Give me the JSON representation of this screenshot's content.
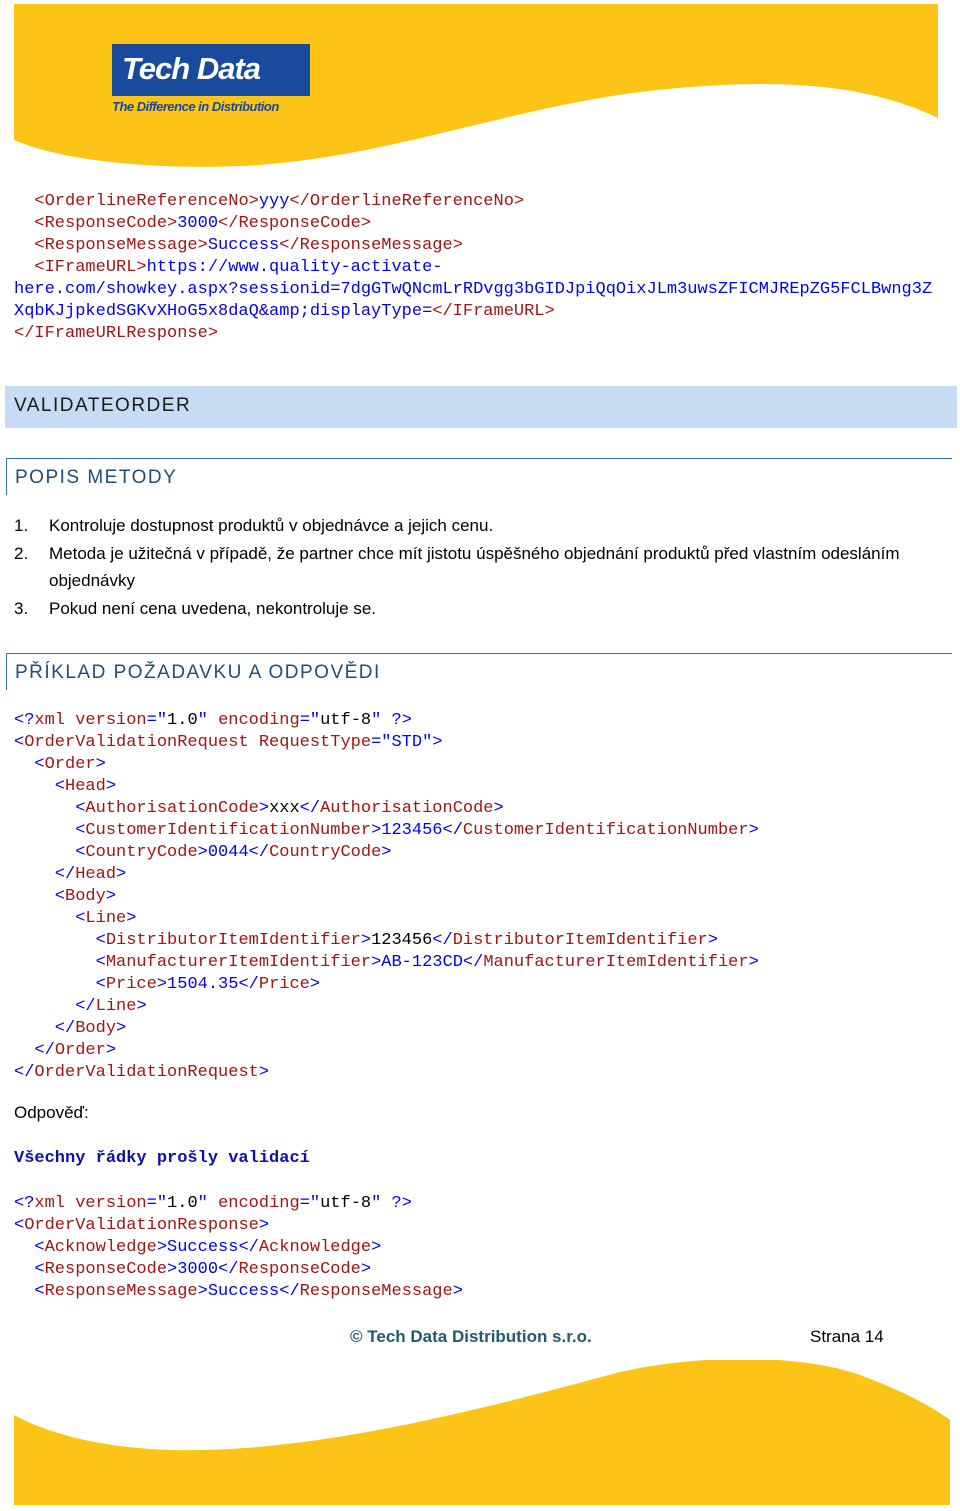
{
  "header": {
    "logo_text": "Tech Data",
    "logo_tagline": "The Difference in Distribution",
    "colors": {
      "wave": "#fcc417",
      "logo_bg": "#1a4a9c"
    }
  },
  "code_top": [
    [
      [
        "  ",
        ""
      ],
      [
        "<OrderlineReferenceNo>",
        "r"
      ],
      [
        "yyy",
        "b"
      ],
      [
        "</OrderlineReferenceNo>",
        "r"
      ]
    ],
    [
      [
        "  ",
        ""
      ],
      [
        "<ResponseCode>",
        "r"
      ],
      [
        "3000",
        "b"
      ],
      [
        "</ResponseCode>",
        "r"
      ]
    ],
    [
      [
        "  ",
        ""
      ],
      [
        "<ResponseMessage>",
        "r"
      ],
      [
        "Success",
        "b"
      ],
      [
        "</ResponseMessage>",
        "r"
      ]
    ],
    [
      [
        "  ",
        ""
      ],
      [
        "<IFrameURL>",
        "r"
      ],
      [
        "https://www.quality-activate-",
        "b"
      ]
    ],
    [
      [
        "here.com/showkey.aspx?sessionid=7dgGTwQNcmLrRDvgg3bGIDJpiQqOixJLm3uwsZFICMJREpZG5FCLBwng3Z",
        "b"
      ]
    ],
    [
      [
        "XqbKJjpkedSGKvXHoG5x8daQ&amp;displayType=",
        "b"
      ],
      [
        "</IFrameURL>",
        "r"
      ]
    ],
    [
      [
        "</IFrameURLResponse>",
        "r"
      ]
    ]
  ],
  "section_title": "VALIDATEORDER",
  "popis": {
    "heading": "POPIS METODY",
    "items": [
      {
        "num": "1.",
        "text": "Kontroluje dostupnost produktů v objednávce a jejich cenu."
      },
      {
        "num": "2.",
        "text": "Metoda je užitečná v případě, že partner chce mít jistotu úspěšného objednání produktů před vlastním odesláním objednávky"
      },
      {
        "num": "3.",
        "text": "Pokud není cena uvedena, nekontroluje se."
      }
    ]
  },
  "example_heading": "PŘÍKLAD POŽADAVKU A ODPOVĚDI",
  "code_request": [
    [
      [
        "<?",
        "b"
      ],
      [
        "xml",
        "r"
      ],
      [
        " version",
        "r"
      ],
      [
        "=\"",
        "b"
      ],
      [
        "1.0",
        "k"
      ],
      [
        "\" ",
        "b"
      ],
      [
        "encoding",
        "r"
      ],
      [
        "=\"",
        "b"
      ],
      [
        "utf-8",
        "k"
      ],
      [
        "\" ?>",
        "b"
      ]
    ],
    [
      [
        "<",
        "b"
      ],
      [
        "OrderValidationRequest",
        "r"
      ],
      [
        " RequestType",
        "r"
      ],
      [
        "=\"",
        "b"
      ],
      [
        "STD",
        "b"
      ],
      [
        "\">",
        "b"
      ]
    ],
    [
      [
        "  <",
        "b"
      ],
      [
        "Order",
        "r"
      ],
      [
        ">",
        "b"
      ]
    ],
    [
      [
        "    <",
        "b"
      ],
      [
        "Head",
        "r"
      ],
      [
        ">",
        "b"
      ]
    ],
    [
      [
        "      <",
        "b"
      ],
      [
        "AuthorisationCode",
        "r"
      ],
      [
        ">",
        "b"
      ],
      [
        "xxx",
        "k"
      ],
      [
        "</",
        "b"
      ],
      [
        "AuthorisationCode",
        "r"
      ],
      [
        ">",
        "b"
      ]
    ],
    [
      [
        "      <",
        "b"
      ],
      [
        "CustomerIdentificationNumber",
        "r"
      ],
      [
        ">",
        "b"
      ],
      [
        "123456",
        "b"
      ],
      [
        "</",
        "b"
      ],
      [
        "CustomerIdentificationNumber",
        "r"
      ],
      [
        ">",
        "b"
      ]
    ],
    [
      [
        "      <",
        "b"
      ],
      [
        "CountryCode",
        "r"
      ],
      [
        ">",
        "b"
      ],
      [
        "0044",
        "b"
      ],
      [
        "</",
        "b"
      ],
      [
        "CountryCode",
        "r"
      ],
      [
        ">",
        "b"
      ]
    ],
    [
      [
        "    </",
        "b"
      ],
      [
        "Head",
        "r"
      ],
      [
        ">",
        "b"
      ]
    ],
    [
      [
        "    <",
        "b"
      ],
      [
        "Body",
        "r"
      ],
      [
        ">",
        "b"
      ]
    ],
    [
      [
        "      <",
        "b"
      ],
      [
        "Line",
        "r"
      ],
      [
        ">",
        "b"
      ]
    ],
    [
      [
        "        <",
        "b"
      ],
      [
        "DistributorItemIdentifier",
        "r"
      ],
      [
        ">",
        "b"
      ],
      [
        "123456",
        "k"
      ],
      [
        "</",
        "b"
      ],
      [
        "DistributorItemIdentifier",
        "r"
      ],
      [
        ">",
        "b"
      ]
    ],
    [
      [
        "        <",
        "b"
      ],
      [
        "ManufacturerItemIdentifier",
        "r"
      ],
      [
        ">",
        "b"
      ],
      [
        "AB-123CD",
        "b"
      ],
      [
        "</",
        "b"
      ],
      [
        "ManufacturerItemIdentifier",
        "r"
      ],
      [
        ">",
        "b"
      ]
    ],
    [
      [
        "        <",
        "b"
      ],
      [
        "Price",
        "r"
      ],
      [
        ">",
        "b"
      ],
      [
        "1504.35",
        "b"
      ],
      [
        "</",
        "b"
      ],
      [
        "Price",
        "r"
      ],
      [
        ">",
        "b"
      ]
    ],
    [
      [
        "      </",
        "b"
      ],
      [
        "Line",
        "r"
      ],
      [
        ">",
        "b"
      ]
    ],
    [
      [
        "    </",
        "b"
      ],
      [
        "Body",
        "r"
      ],
      [
        ">",
        "b"
      ]
    ],
    [
      [
        "  </",
        "b"
      ],
      [
        "Order",
        "r"
      ],
      [
        ">",
        "b"
      ]
    ],
    [
      [
        "</",
        "b"
      ],
      [
        "OrderValidationRequest",
        "r"
      ],
      [
        ">",
        "b"
      ]
    ]
  ],
  "response_label": "Odpověď:",
  "validation_message": "Všechny řádky prošly validací",
  "code_response": [
    [
      [
        "<?",
        "b"
      ],
      [
        "xml",
        "r"
      ],
      [
        " version",
        "r"
      ],
      [
        "=\"",
        "b"
      ],
      [
        "1.0",
        "k"
      ],
      [
        "\" ",
        "b"
      ],
      [
        "encoding",
        "r"
      ],
      [
        "=\"",
        "b"
      ],
      [
        "utf-8",
        "k"
      ],
      [
        "\" ?>",
        "b"
      ]
    ],
    [
      [
        "<",
        "b"
      ],
      [
        "OrderValidationResponse",
        "r"
      ],
      [
        ">",
        "b"
      ]
    ],
    [
      [
        "  <",
        "b"
      ],
      [
        "Acknowledge",
        "r"
      ],
      [
        ">",
        "b"
      ],
      [
        "Success",
        "b"
      ],
      [
        "</",
        "b"
      ],
      [
        "Acknowledge",
        "r"
      ],
      [
        ">",
        "b"
      ]
    ],
    [
      [
        "  <",
        "b"
      ],
      [
        "ResponseCode",
        "r"
      ],
      [
        ">",
        "b"
      ],
      [
        "3000",
        "b"
      ],
      [
        "</",
        "b"
      ],
      [
        "ResponseCode",
        "r"
      ],
      [
        ">",
        "b"
      ]
    ],
    [
      [
        "  <",
        "b"
      ],
      [
        "ResponseMessage",
        "r"
      ],
      [
        ">",
        "b"
      ],
      [
        "Success",
        "b"
      ],
      [
        "</",
        "b"
      ],
      [
        "ResponseMessage",
        "r"
      ],
      [
        ">",
        "b"
      ]
    ]
  ],
  "footer": {
    "copyright": "© Tech Data Distribution s.r.o.",
    "page": "Strana 14"
  }
}
